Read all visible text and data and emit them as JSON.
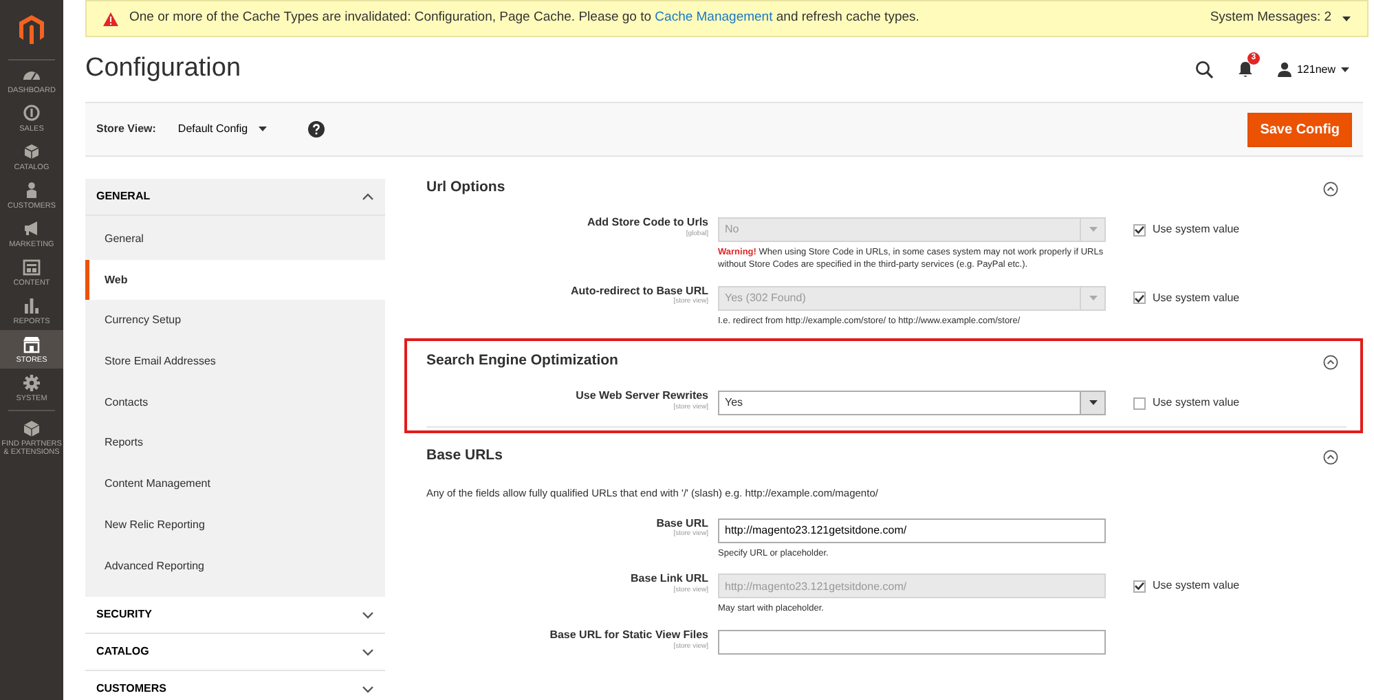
{
  "admin_menu": [
    {
      "label": "DASHBOARD",
      "selected": false
    },
    {
      "label": "SALES",
      "selected": false
    },
    {
      "label": "CATALOG",
      "selected": false
    },
    {
      "label": "CUSTOMERS",
      "selected": false
    },
    {
      "label": "MARKETING",
      "selected": false
    },
    {
      "label": "CONTENT",
      "selected": false
    },
    {
      "label": "REPORTS",
      "selected": false
    },
    {
      "label": "STORES",
      "selected": true
    },
    {
      "label": "SYSTEM",
      "selected": false
    },
    {
      "label": "FIND PARTNERS & EXTENSIONS",
      "selected": false
    }
  ],
  "system_message": {
    "before": "One or more of the Cache Types are invalidated: Configuration, Page Cache. Please go to",
    "link": "Cache Management",
    "after": "and refresh cache types.",
    "counter": "System Messages: 2"
  },
  "page_title": "Configuration",
  "header_actions": {
    "notifications_badge": "3",
    "user": "121new"
  },
  "store_view": {
    "label": "Store View:",
    "value": "Default Config"
  },
  "save_button": "Save Config",
  "config_nav": [
    {
      "title": "GENERAL",
      "expanded": true,
      "items": [
        {
          "label": "General",
          "selected": false
        },
        {
          "label": "Web",
          "selected": true
        },
        {
          "label": "Currency Setup",
          "selected": false
        },
        {
          "label": "Store Email Addresses",
          "selected": false
        },
        {
          "label": "Contacts",
          "selected": false
        },
        {
          "label": "Reports",
          "selected": false
        },
        {
          "label": "Content Management",
          "selected": false
        },
        {
          "label": "New Relic Reporting",
          "selected": false
        },
        {
          "label": "Advanced Reporting",
          "selected": false
        }
      ]
    },
    {
      "title": "SECURITY",
      "expanded": false
    },
    {
      "title": "CATALOG",
      "expanded": false
    },
    {
      "title": "CUSTOMERS",
      "expanded": false
    }
  ],
  "sections": [
    {
      "title": "Url Options",
      "highlighted": false,
      "expanded": true,
      "fields": [
        {
          "label": "Add Store Code to Urls",
          "scope": "[global]",
          "kind": "select",
          "value": "No",
          "disabled": true,
          "use_system_value": true,
          "use_system_value_label": "Use system value",
          "note": "**Warning!** When using Store Code in URLs, in some cases system may not work properly if URLs without Store Codes are specified in the third-party services (e.g. PayPal etc.)."
        },
        {
          "label": "Auto-redirect to Base URL",
          "scope": "[store view]",
          "kind": "select",
          "value": "Yes (302 Found)",
          "disabled": true,
          "use_system_value": true,
          "use_system_value_label": "Use system value",
          "note": "I.e. redirect from http://example.com/store/ to http://www.example.com/store/"
        }
      ]
    },
    {
      "title": "Search Engine Optimization",
      "highlighted": true,
      "expanded": true,
      "fields": [
        {
          "label": "Use Web Server Rewrites",
          "scope": "[store view]",
          "kind": "select",
          "value": "Yes",
          "disabled": false,
          "use_system_value": false,
          "use_system_value_label": "Use system value"
        }
      ]
    },
    {
      "title": "Base URLs",
      "highlighted": false,
      "expanded": true,
      "description": "Any of the fields allow fully qualified URLs that end with '/' (slash) e.g. http://example.com/magento/",
      "fields": [
        {
          "label": "Base URL",
          "scope": "[store view]",
          "kind": "input",
          "value": "http://magento23.121getsitdone.com/",
          "disabled": false,
          "note": "Specify URL or placeholder."
        },
        {
          "label": "Base Link URL",
          "scope": "[store view]",
          "kind": "input",
          "value": "http://magento23.121getsitdone.com/",
          "disabled": true,
          "use_system_value": true,
          "use_system_value_label": "Use system value",
          "note": "May start with placeholder."
        },
        {
          "label": "Base URL for Static View Files",
          "scope": "[store view]",
          "kind": "input",
          "disabled": false
        }
      ]
    }
  ]
}
